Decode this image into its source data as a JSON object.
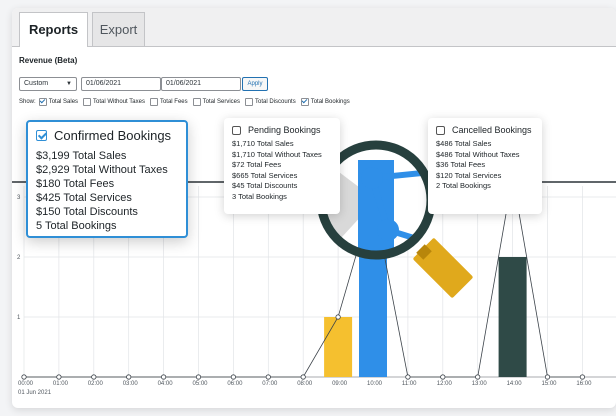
{
  "tabs": [
    {
      "label": "Reports",
      "active": true
    },
    {
      "label": "Export",
      "active": false
    }
  ],
  "section_title": "Revenue (Beta)",
  "controls": {
    "range_select": "Custom",
    "start_date": "01/06/2021",
    "end_date": "01/06/2021",
    "apply_label": "Apply"
  },
  "filters": {
    "show_label": "Show:",
    "items": [
      {
        "label": "Total Sales",
        "checked": true
      },
      {
        "label": "Total Without Taxes",
        "checked": false
      },
      {
        "label": "Total Fees",
        "checked": false
      },
      {
        "label": "Total Services",
        "checked": false
      },
      {
        "label": "Total Discounts",
        "checked": false
      },
      {
        "label": "Total Bookings",
        "checked": true
      }
    ]
  },
  "tooltips": {
    "confirmed": {
      "title": "Confirmed Bookings",
      "rows": [
        {
          "value": "$3,199",
          "label": "Total Sales"
        },
        {
          "value": "$2,929",
          "label": "Total Without Taxes"
        },
        {
          "value": "$180",
          "label": "Total Fees"
        },
        {
          "value": "$425",
          "label": "Total Services"
        },
        {
          "value": "$150",
          "label": "Total Discounts"
        },
        {
          "value": "5",
          "label": "Total Bookings"
        }
      ]
    },
    "pending": {
      "title": "Pending Bookings",
      "rows": [
        {
          "value": "$1,710",
          "label": "Total Sales"
        },
        {
          "value": "$1,710",
          "label": "Total Without Taxes"
        },
        {
          "value": "$72",
          "label": "Total Fees"
        },
        {
          "value": "$665",
          "label": "Total Services"
        },
        {
          "value": "$45",
          "label": "Total Discounts"
        },
        {
          "value": "3",
          "label": "Total Bookings"
        }
      ]
    },
    "cancelled": {
      "title": "Cancelled Bookings",
      "rows": [
        {
          "value": "$486",
          "label": "Total Sales"
        },
        {
          "value": "$486",
          "label": "Total Without Taxes"
        },
        {
          "value": "$36",
          "label": "Total Fees"
        },
        {
          "value": "$120",
          "label": "Total Services"
        },
        {
          "value": "2",
          "label": "Total Bookings"
        }
      ]
    }
  },
  "chart_data": {
    "type": "bar",
    "x": [
      "00:00",
      "01:00",
      "02:00",
      "03:00",
      "04:00",
      "05:00",
      "06:00",
      "07:00",
      "08:00",
      "09:00",
      "10:00",
      "11:00",
      "12:00",
      "13:00",
      "14:00",
      "15:00",
      "16:00"
    ],
    "date_label": "01 Jun 2021",
    "yticks": [
      1,
      2,
      3
    ],
    "ylim": [
      0,
      3.5
    ],
    "bars": [
      {
        "x": "09:00",
        "value": 1,
        "color": "#f5c02f"
      },
      {
        "x": "10:00",
        "value": 3,
        "color": "#2f8fe8"
      },
      {
        "x": "14:00",
        "value": 2,
        "color": "#2f4a47"
      }
    ],
    "line_values": [
      0,
      0,
      0,
      0,
      0,
      0,
      0,
      0,
      0,
      1,
      3,
      0,
      0,
      0,
      3.35,
      0,
      0
    ]
  },
  "colors": {
    "confirmed_border": "#2f8fd6",
    "pending_bar": "#2f8fe8",
    "yellow_bar": "#f5c02f",
    "cancelled_bar": "#2f4a47",
    "magnifier_ring": "#27403e",
    "magnifier_handle": "#e0a91c"
  },
  "icons": {
    "magnifier": "magnifier-icon"
  }
}
